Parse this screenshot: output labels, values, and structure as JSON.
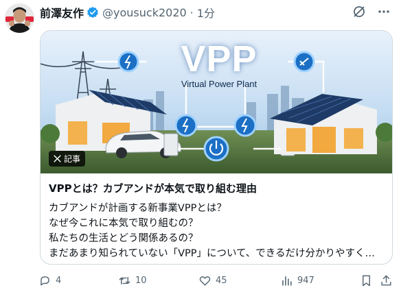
{
  "post": {
    "author_name": "前澤友作",
    "handle": "@yousuck2020",
    "separator": "·",
    "time": "1分"
  },
  "card": {
    "image_headline": "VPP",
    "image_subtitle": "Virtual Power Plant",
    "badge_label": "記事",
    "title": "VPPとは？カブアンドが本気で取り組む理由",
    "description": [
      "カブアンドが計画する新事業VPPとは？",
      "なぜ今これに本気で取り組むの？",
      "私たちの生活とどう関係あるの？",
      "まだあまり知られていない「VPP」について、できるだけ分かりやすく…"
    ]
  },
  "actions": {
    "replies": "4",
    "reposts": "10",
    "likes": "45",
    "views": "947"
  },
  "colors": {
    "text": "#0f1419",
    "muted": "#536471",
    "verified": "#1d9bf0",
    "border": "#cfd9de"
  },
  "icons": [
    "avatar",
    "verified-badge-icon",
    "grok-icon",
    "more-icon",
    "x-logo-icon",
    "reply-icon",
    "repost-icon",
    "like-icon",
    "views-icon",
    "bookmark-icon",
    "share-icon"
  ]
}
